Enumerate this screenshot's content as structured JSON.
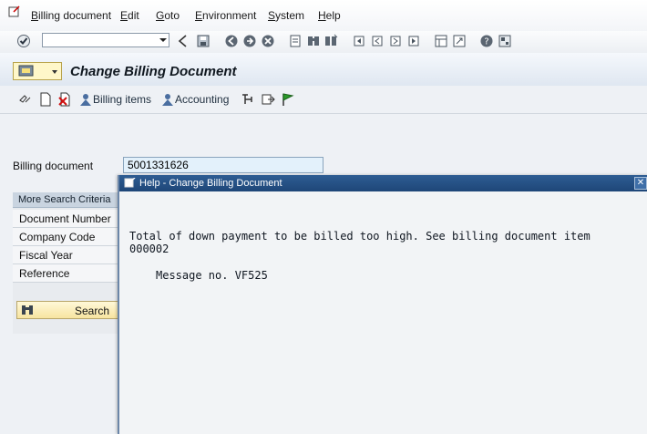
{
  "menubar": {
    "items": [
      "Billing document",
      "Edit",
      "Goto",
      "Environment",
      "System",
      "Help"
    ]
  },
  "title": "Change Billing Document",
  "app_toolbar": {
    "billing_items": "Billing items",
    "accounting": "Accounting"
  },
  "form": {
    "billing_document_label": "Billing document",
    "billing_document_value": "5001331626"
  },
  "search_panel": {
    "header": "More Search Criteria",
    "criteria": [
      "Document Number",
      "Company Code",
      "Fiscal Year",
      "Reference"
    ],
    "search_label": "Search"
  },
  "popup": {
    "title": "Help - Change Billing Document",
    "message_line1": "Total of down payment to be billed too high. See billing document item",
    "message_line2": "000002",
    "message_no": "Message no. VF525"
  },
  "colors": {
    "popup_title_bg": "#1e4678",
    "search_button_bg": "#f7e4a0",
    "field_bg": "#e3f1fb"
  }
}
